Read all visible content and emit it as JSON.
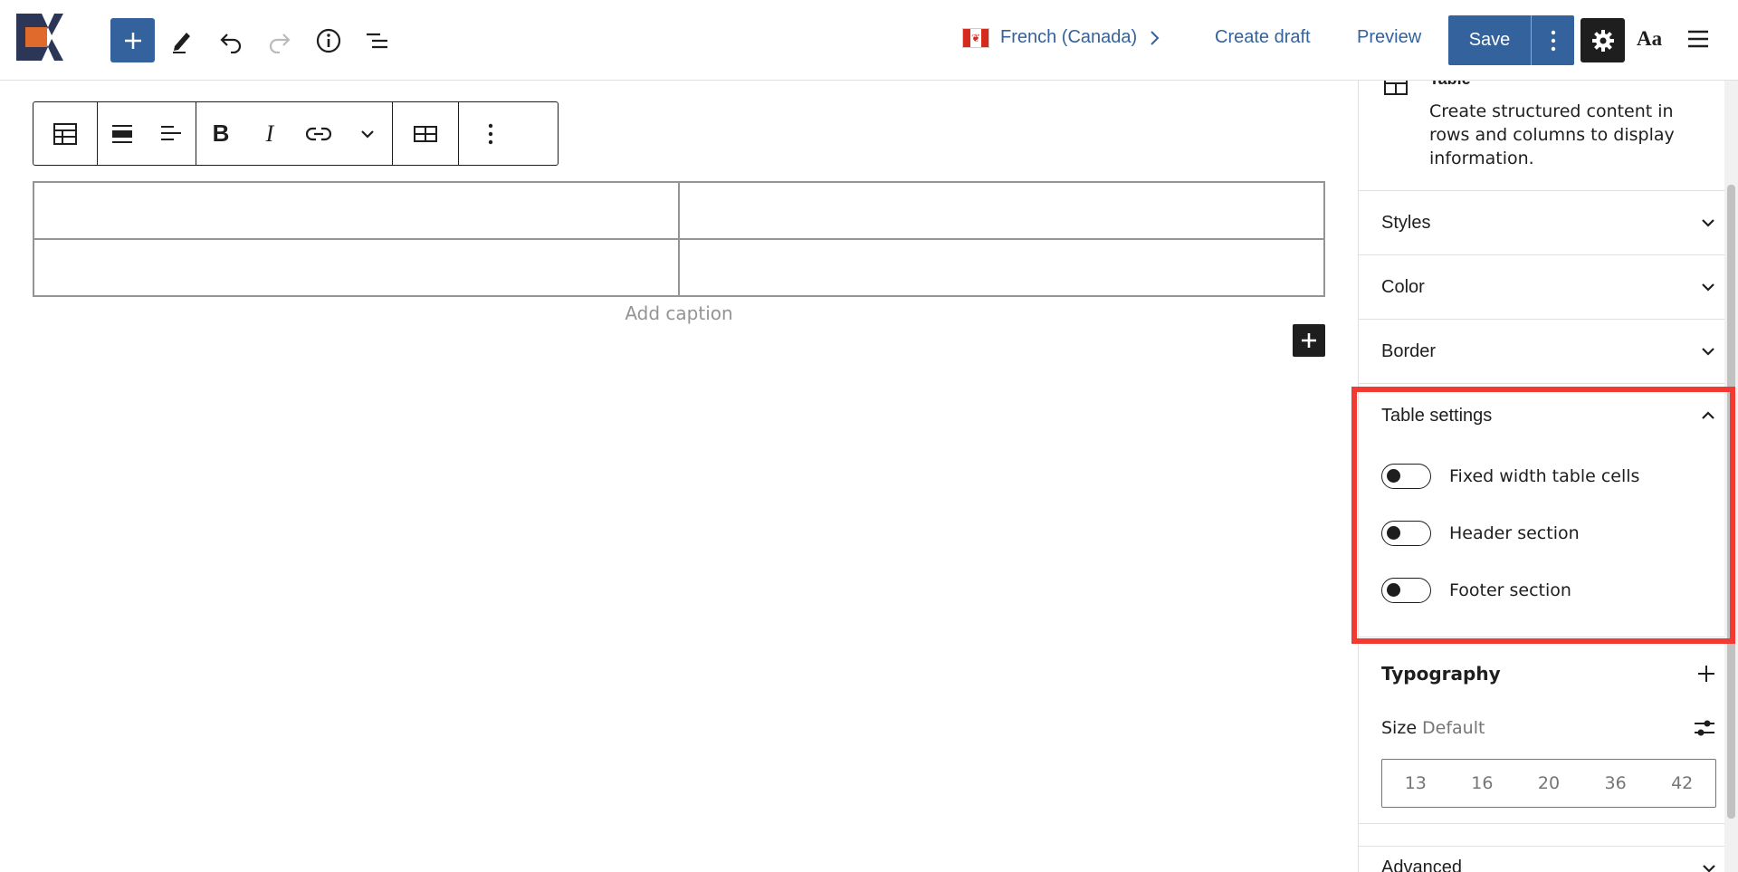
{
  "topbar": {
    "language": "French (Canada)",
    "create_draft": "Create draft",
    "preview": "Preview",
    "save": "Save",
    "styles_label": "Aa",
    "icons": [
      "logo",
      "plus-icon",
      "pencil-icon",
      "undo-icon",
      "redo-icon",
      "info-icon",
      "list-view-icon",
      "canada-flag-icon",
      "chevron-right-icon",
      "kebab-menu-icon",
      "gear-icon",
      "hamburger-icon"
    ]
  },
  "block_toolbar": {
    "icons": [
      "table-icon",
      "align-full-icon",
      "align-left-icon",
      "bold-icon",
      "italic-icon",
      "link-icon",
      "chevron-down-icon",
      "edit-table-icon",
      "kebab-menu-icon"
    ],
    "bold": "B",
    "italic": "I"
  },
  "table": {
    "rows": [
      [
        "",
        ""
      ],
      [
        "",
        ""
      ]
    ],
    "caption_placeholder": "Add caption"
  },
  "sidebar": {
    "block": {
      "name": "Table",
      "description": "Create structured content in rows and columns to display information."
    },
    "panels": [
      {
        "label": "Styles",
        "expanded": false
      },
      {
        "label": "Color",
        "expanded": false
      },
      {
        "label": "Border",
        "expanded": false
      }
    ],
    "table_settings": {
      "label": "Table settings",
      "toggles": [
        {
          "label": "Fixed width table cells",
          "checked": false
        },
        {
          "label": "Header section",
          "checked": false
        },
        {
          "label": "Footer section",
          "checked": false
        }
      ]
    },
    "typography": {
      "label": "Typography",
      "size_label": "Size",
      "size_value": "Default",
      "sizes": [
        "13",
        "16",
        "20",
        "36",
        "42"
      ]
    },
    "advanced": "Advanced"
  },
  "colors": {
    "accent": "#34629c",
    "highlight": "#f23a32",
    "dark": "#1e1e1e"
  }
}
